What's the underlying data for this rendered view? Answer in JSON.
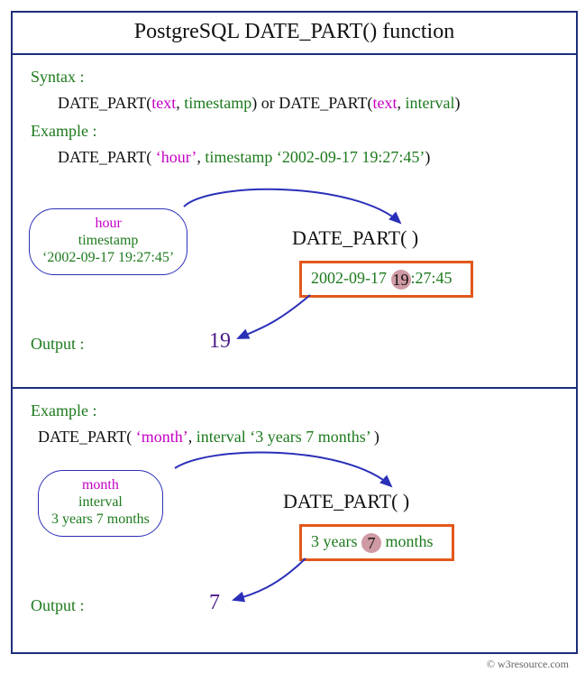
{
  "title": "PostgreSQL  DATE_PART() function",
  "syntaxLabel": "Syntax :",
  "syntax": {
    "fn1": "DATE_PART(",
    "a1": "text",
    "sep": ", ",
    "a2": "timestamp",
    "close": ")",
    "or": " or ",
    "fn2": "DATE_PART(",
    "b1": "text",
    "b2": "interval",
    "close2": ")"
  },
  "ex1": {
    "label": "Example :",
    "callPre": "DATE_PART( ",
    "argText": "‘hour’",
    "argSep": ", ",
    "argTs": "timestamp ‘2002-09-17 19:27:45’",
    "callPost": ")",
    "bubbleTop": "hour",
    "bubbleMid": "timestamp",
    "bubbleBot": "‘2002-09-17 19:27:45’",
    "dp": "DATE_PART(  )",
    "boxPre": "2002-09-17 ",
    "boxHl": "19",
    "boxPost": ":27:45",
    "outLabel": "Output :",
    "outVal": "19"
  },
  "ex2": {
    "label": "Example :",
    "callPre": "DATE_PART( ",
    "argText": "‘month’",
    "argSep": ", ",
    "argTs": "interval ‘3 years 7 months’ ",
    "callPost": ")",
    "bubbleTop": "month",
    "bubbleMid": "interval",
    "bubbleBot": "3 years 7 months",
    "dp": "DATE_PART(  )",
    "boxPre": "3 years ",
    "boxHl": "7",
    "boxPost": " months",
    "outLabel": "Output :",
    "outVal": "7"
  },
  "credit": "© w3resource.com"
}
